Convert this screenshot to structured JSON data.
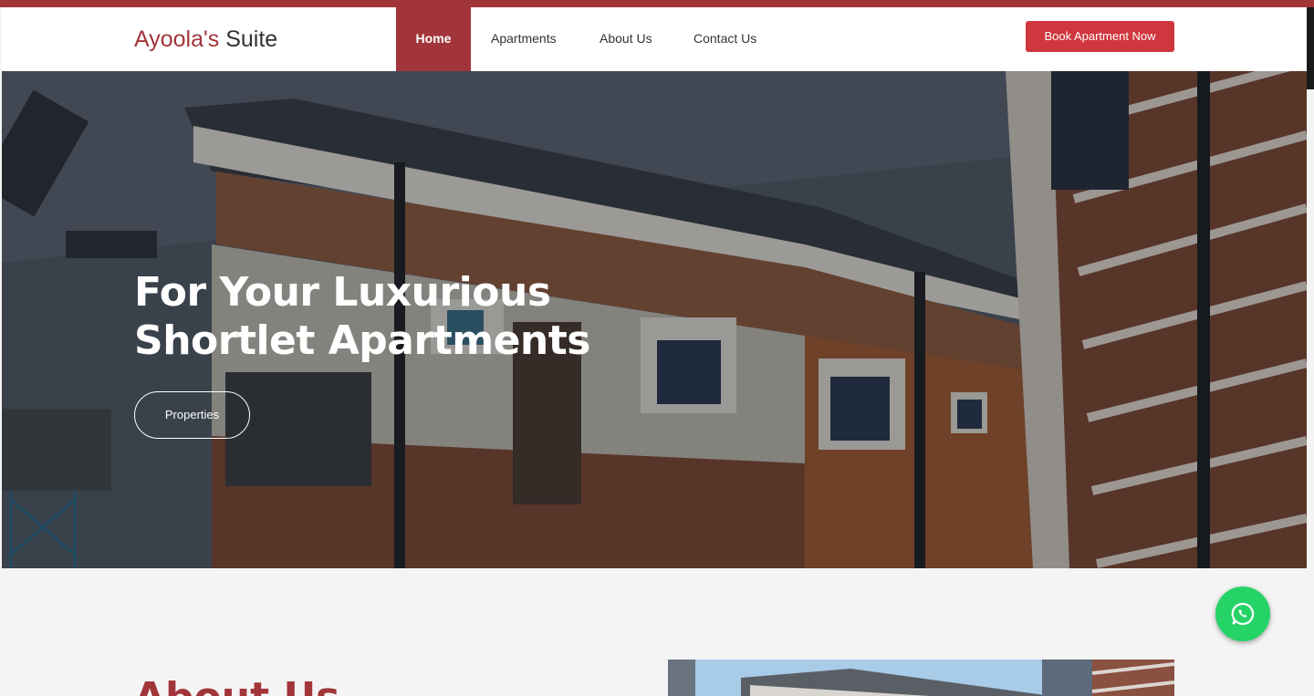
{
  "brand": {
    "part1": "Ayoola's",
    "part2": " Suite"
  },
  "nav": {
    "items": [
      {
        "label": "Home",
        "active": true
      },
      {
        "label": "Apartments",
        "active": false
      },
      {
        "label": "About Us",
        "active": false
      },
      {
        "label": "Contact Us",
        "active": false
      }
    ],
    "cta_label": "Book Apartment Now"
  },
  "hero": {
    "title": "For Your Luxurious Shortlet Apartments",
    "button_label": "Properties"
  },
  "about": {
    "title": "About Us"
  },
  "floating": {
    "icon": "whatsapp-icon"
  },
  "colors": {
    "brand": "#a2353a",
    "cta": "#d0363d",
    "whatsapp": "#25d366"
  }
}
